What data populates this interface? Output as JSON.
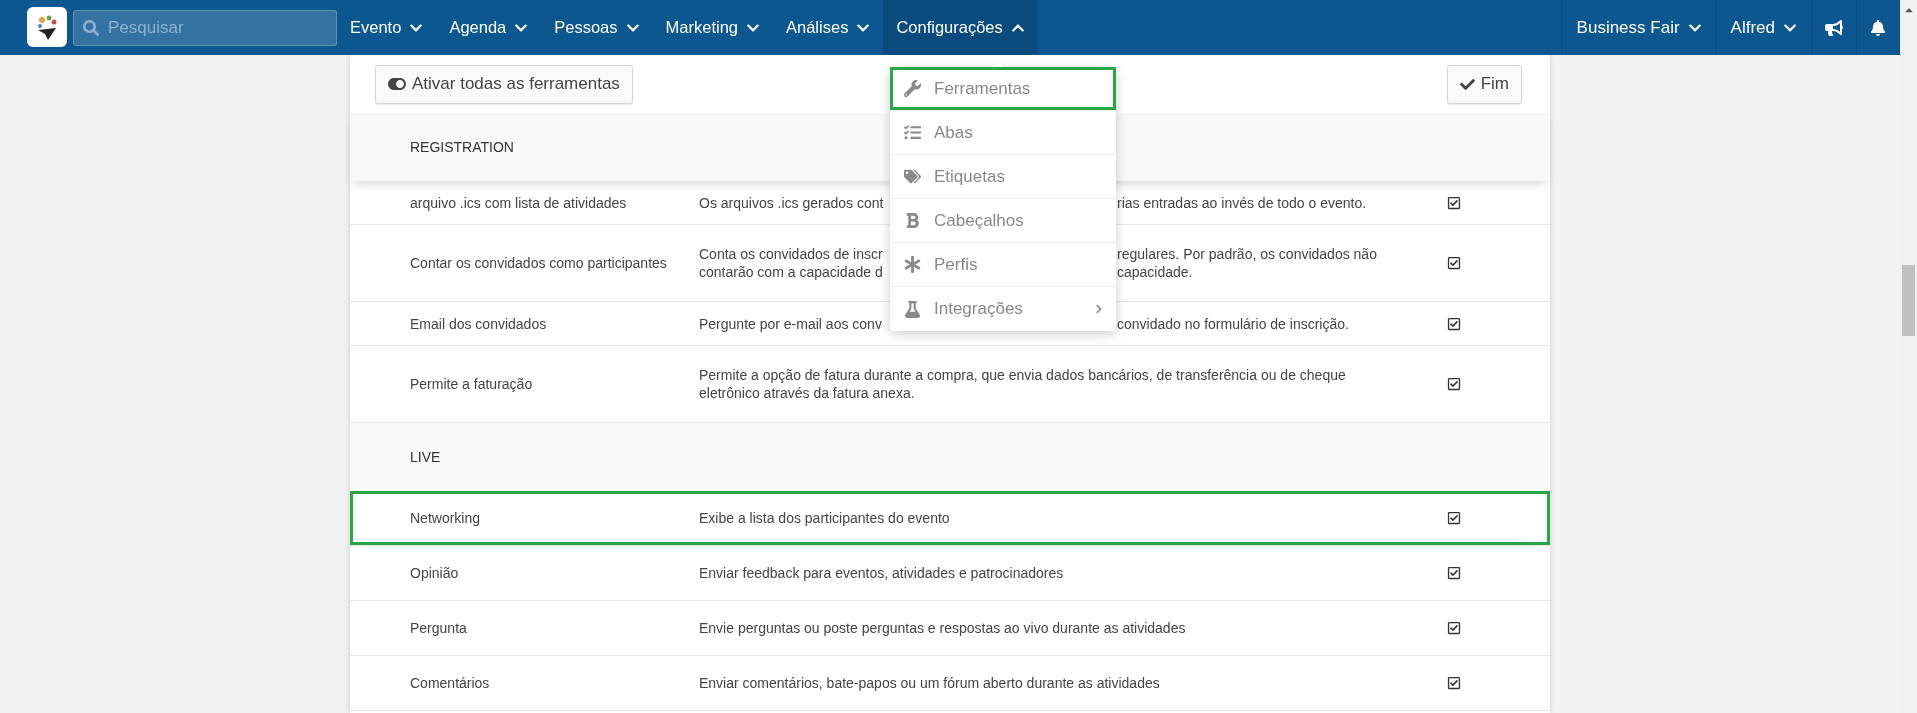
{
  "navbar": {
    "search": {
      "placeholder": "Pesquisar"
    },
    "menu": [
      {
        "label": "Evento",
        "expanded": false
      },
      {
        "label": "Agenda",
        "expanded": false
      },
      {
        "label": "Pessoas",
        "expanded": false
      },
      {
        "label": "Marketing",
        "expanded": false
      },
      {
        "label": "Análises",
        "expanded": false
      },
      {
        "label": "Configurações",
        "expanded": true
      }
    ],
    "event": "Business Fair",
    "user": "Alfred"
  },
  "dropdown": [
    {
      "label": "Ferramentas",
      "highlighted": true,
      "submenu": false
    },
    {
      "label": "Abas",
      "highlighted": false,
      "submenu": false
    },
    {
      "label": "Etiquetas",
      "highlighted": false,
      "submenu": false
    },
    {
      "label": "Cabeçalhos",
      "highlighted": false,
      "submenu": false
    },
    {
      "label": "Perfis",
      "highlighted": false,
      "submenu": false
    },
    {
      "label": "Integrações",
      "highlighted": false,
      "submenu": true
    }
  ],
  "toolbar": {
    "toggle_all": "Ativar todas as ferramentas",
    "done": "Fim"
  },
  "groups": [
    {
      "title": "REGISTRATION",
      "rows": [
        {
          "name": "arquivo .ics com lista de atividades",
          "kind": "covered",
          "description_start": [
            "Os arquivos .ics gerados cont"
          ],
          "description_end": [
            "rias entradas ao invés de todo o evento."
          ],
          "checked": true,
          "highlighted": false
        },
        {
          "name": "Contar os convidados como participantes",
          "kind": "covered",
          "description_start": [
            "Conta os convidados de inscr",
            "contarão com a capacidade d"
          ],
          "description_end": [
            "regulares. Por padrão, os convidados não",
            "capacidade."
          ],
          "checked": true,
          "highlighted": false
        },
        {
          "name": "Email dos convidados",
          "kind": "covered",
          "description_start": [
            "Pergunte por e-mail aos conv"
          ],
          "description_end": [
            "convidado no formulário de inscrição."
          ],
          "checked": true,
          "highlighted": false
        },
        {
          "name": "Permite a faturação",
          "kind": "plain",
          "description": "Permite a opção de fatura durante a compra, que envia dados bancários, de transferência ou de cheque eletrônico através da fatura anexa.",
          "checked": true,
          "highlighted": false
        }
      ]
    },
    {
      "title": "LIVE",
      "rows": [
        {
          "name": "Networking",
          "kind": "plain",
          "description": "Exibe a lista dos participantes do evento",
          "checked": true,
          "highlighted": true
        },
        {
          "name": "Opinião",
          "kind": "plain",
          "description": "Enviar feedback para eventos, atividades e patrocinadores",
          "checked": true,
          "highlighted": false
        },
        {
          "name": "Pergunta",
          "kind": "plain",
          "description": "Envie perguntas ou poste perguntas e respostas ao vivo durante as atividades",
          "checked": true,
          "highlighted": false
        },
        {
          "name": "Comentários",
          "kind": "plain",
          "description": "Enviar comentários, bate-papos ou um fórum aberto durante as atividades",
          "checked": true,
          "highlighted": false
        }
      ]
    }
  ]
}
